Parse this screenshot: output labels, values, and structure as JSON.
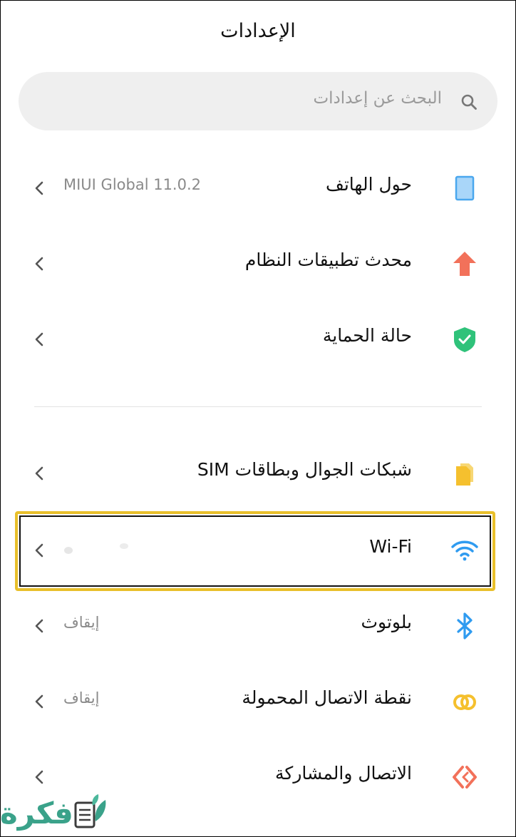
{
  "header": {
    "title": "الإعدادات"
  },
  "search": {
    "placeholder": "البحث عن إعدادات",
    "icon": "search-icon"
  },
  "items": [
    {
      "label": "حول الهاتف",
      "value": "MIUI Global 11.0.2",
      "icon": "phone-icon",
      "color": "#5ab1f0"
    },
    {
      "label": "محدث تطبيقات النظام",
      "value": "",
      "icon": "arrow-up-icon",
      "color": "#f2715a"
    },
    {
      "label": "حالة الحماية",
      "value": "",
      "icon": "shield-check-icon",
      "color": "#2fc27a"
    },
    {
      "label": "شبكات الجوال وبطاقات SIM",
      "value": "",
      "icon": "sim-card-icon",
      "color": "#f5c02e"
    },
    {
      "label": "Wi-Fi",
      "value": "",
      "icon": "wifi-icon",
      "color": "#2f9bf0"
    },
    {
      "label": "بلوتوث",
      "value": "إيقاف",
      "icon": "bluetooth-icon",
      "color": "#2f9bf0"
    },
    {
      "label": "نقطة الاتصال المحمولة",
      "value": "إيقاف",
      "icon": "hotspot-icon",
      "color": "#f5c02e"
    },
    {
      "label": "الاتصال والمشاركة",
      "value": "",
      "icon": "share-icon",
      "color": "#f2715a"
    }
  ],
  "watermark": {
    "text": "فكرة"
  }
}
